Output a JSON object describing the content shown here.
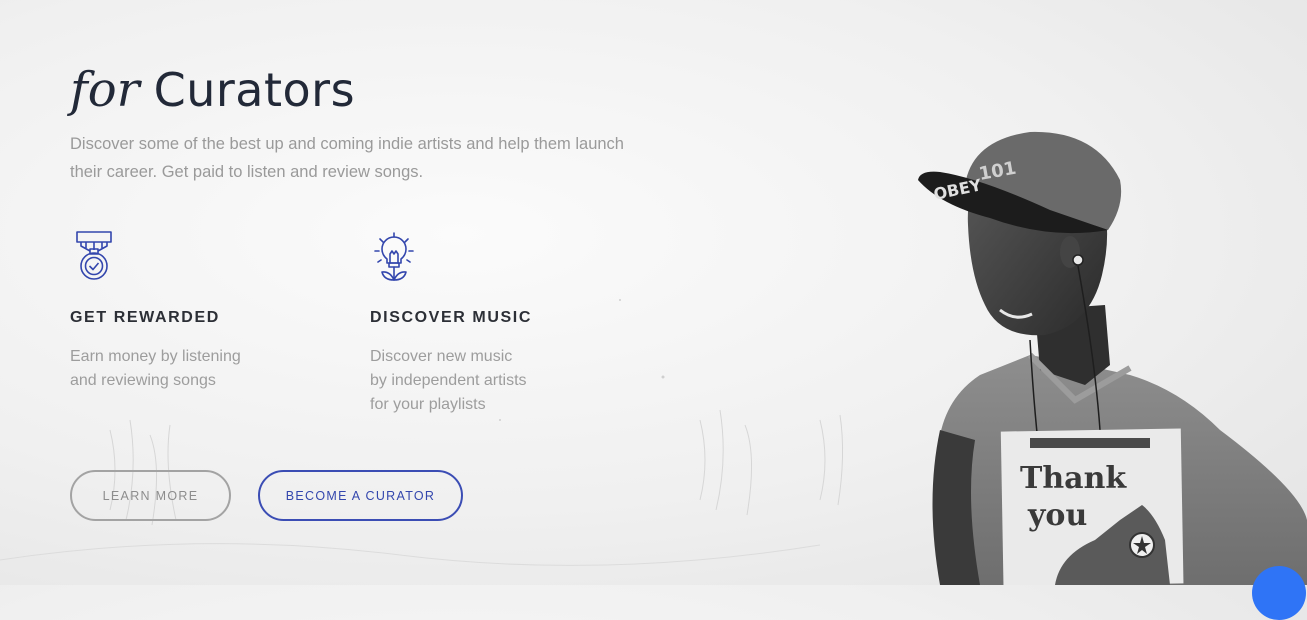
{
  "hero": {
    "title_em": "for",
    "title_main": "Curators",
    "subtitle": "Discover some of the best up and coming indie artists and help them launch their career. Get paid to listen and review songs."
  },
  "features": [
    {
      "icon": "medal-icon",
      "title": "GET REWARDED",
      "description": "Earn money by listening\nand reviewing songs"
    },
    {
      "icon": "lightbulb-icon",
      "title": "DISCOVER MUSIC",
      "description": "Discover new music\nby independent artists\nfor your playlists"
    }
  ],
  "buttons": {
    "learn_more": "LEARN MORE",
    "become_curator": "BECOME A CURATOR"
  },
  "photo": {
    "shirt_text_line1": "Thank",
    "shirt_text_line2": "you"
  },
  "colors": {
    "accent": "#3346ad",
    "heading": "#222938",
    "muted_text": "#9a9a9a",
    "chat_widget": "#2f74f6"
  }
}
